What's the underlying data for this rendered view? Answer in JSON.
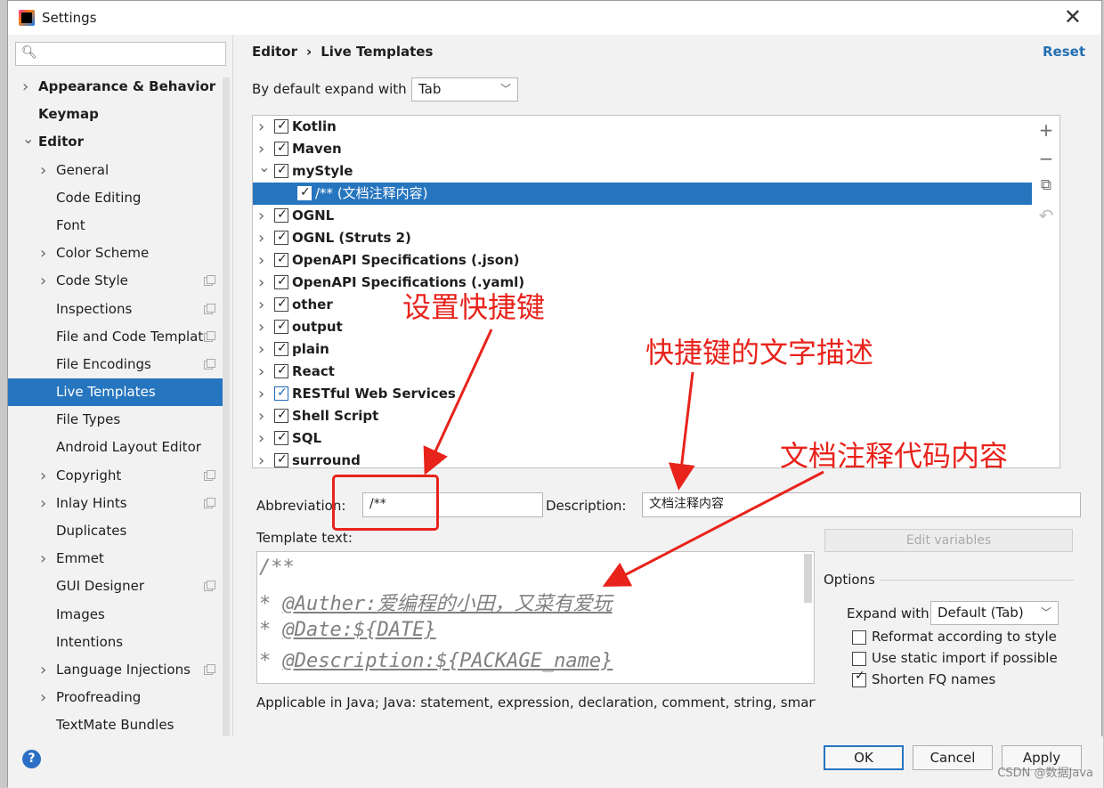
{
  "window": {
    "title": "Settings"
  },
  "search": {
    "placeholder": ""
  },
  "sidebar": {
    "items": [
      {
        "label": "Appearance & Behavior",
        "bold": true,
        "arrow": "right",
        "indent": 0
      },
      {
        "label": "Keymap",
        "bold": true,
        "arrow": "",
        "indent": 0
      },
      {
        "label": "Editor",
        "bold": true,
        "arrow": "down",
        "indent": 0
      },
      {
        "label": "General",
        "arrow": "right",
        "indent": 1
      },
      {
        "label": "Code Editing",
        "arrow": "",
        "indent": 1
      },
      {
        "label": "Font",
        "arrow": "",
        "indent": 1
      },
      {
        "label": "Color Scheme",
        "arrow": "right",
        "indent": 1
      },
      {
        "label": "Code Style",
        "arrow": "right",
        "indent": 1,
        "copy": true
      },
      {
        "label": "Inspections",
        "arrow": "",
        "indent": 1,
        "copy": true
      },
      {
        "label": "File and Code Templat",
        "arrow": "",
        "indent": 1,
        "copy": true
      },
      {
        "label": "File Encodings",
        "arrow": "",
        "indent": 1,
        "copy": true
      },
      {
        "label": "Live Templates",
        "arrow": "",
        "indent": 1,
        "selected": true
      },
      {
        "label": "File Types",
        "arrow": "",
        "indent": 1
      },
      {
        "label": "Android Layout Editor",
        "arrow": "",
        "indent": 1
      },
      {
        "label": "Copyright",
        "arrow": "right",
        "indent": 1,
        "copy": true
      },
      {
        "label": "Inlay Hints",
        "arrow": "right",
        "indent": 1,
        "copy": true
      },
      {
        "label": "Duplicates",
        "arrow": "",
        "indent": 1
      },
      {
        "label": "Emmet",
        "arrow": "right",
        "indent": 1
      },
      {
        "label": "GUI Designer",
        "arrow": "",
        "indent": 1,
        "copy": true
      },
      {
        "label": "Images",
        "arrow": "",
        "indent": 1
      },
      {
        "label": "Intentions",
        "arrow": "",
        "indent": 1
      },
      {
        "label": "Language Injections",
        "arrow": "right",
        "indent": 1,
        "copy": true
      },
      {
        "label": "Proofreading",
        "arrow": "right",
        "indent": 1
      },
      {
        "label": "TextMate Bundles",
        "arrow": "",
        "indent": 1
      }
    ]
  },
  "breadcrumb": {
    "part1": "Editor",
    "sep": "›",
    "part2": "Live Templates"
  },
  "reset_label": "Reset",
  "expand": {
    "label": "By default expand with",
    "value": "Tab"
  },
  "tree": {
    "rows": [
      {
        "label": "Kotlin",
        "arrow": "right"
      },
      {
        "label": "Maven",
        "arrow": "right"
      },
      {
        "label": "myStyle",
        "arrow": "down"
      },
      {
        "label": "/** (文档注释内容)",
        "child": true,
        "selected": true
      },
      {
        "label": "OGNL",
        "arrow": "right"
      },
      {
        "label": "OGNL (Struts 2)",
        "arrow": "right"
      },
      {
        "label": "OpenAPI Specifications (.json)",
        "arrow": "right"
      },
      {
        "label": "OpenAPI Specifications (.yaml)",
        "arrow": "right"
      },
      {
        "label": "other",
        "arrow": "right"
      },
      {
        "label": "output",
        "arrow": "right"
      },
      {
        "label": "plain",
        "arrow": "right"
      },
      {
        "label": "React",
        "arrow": "right"
      },
      {
        "label": "RESTful Web Services",
        "arrow": "right",
        "blue": true
      },
      {
        "label": "Shell Script",
        "arrow": "right"
      },
      {
        "label": "SQL",
        "arrow": "right"
      },
      {
        "label": "surround",
        "arrow": "right"
      }
    ]
  },
  "tools": {
    "add": "+",
    "remove": "−",
    "copy": "⧉",
    "undo": "↶"
  },
  "abbreviation": {
    "label": "Abbreviation:",
    "value": "/**"
  },
  "description": {
    "label": "Description:",
    "value": "文档注释内容"
  },
  "template_text": {
    "label": "Template text:",
    "lines": [
      "/**",
      "* @Auther:爱编程的小田，又菜有爱玩",
      "* @Date:${DATE}",
      "* @Description:${PACKAGE_name}"
    ]
  },
  "edit_variables_label": "Edit variables",
  "applicable_text": "Applicable in Java; Java: statement, expression, declaration, comment, string, smart typ",
  "options": {
    "title": "Options",
    "expand_label": "Expand with",
    "expand_value": "Default (Tab)",
    "checks": [
      {
        "label": "Reformat according to style",
        "checked": false
      },
      {
        "label": "Use static import if possible",
        "checked": false
      },
      {
        "label": "Shorten FQ names",
        "checked": true
      }
    ]
  },
  "buttons": {
    "ok": "OK",
    "cancel": "Cancel",
    "apply": "Apply",
    "help": "?"
  },
  "annotations": {
    "shortcut": "设置快捷键",
    "shortcut_desc": "快捷键的文字描述",
    "doc_content": "文档注释代码内容"
  },
  "watermark": "CSDN @数据Java",
  "colors": {
    "selection": "#2675bf",
    "accent": "#2470b3",
    "annotation": "#e8231c"
  }
}
